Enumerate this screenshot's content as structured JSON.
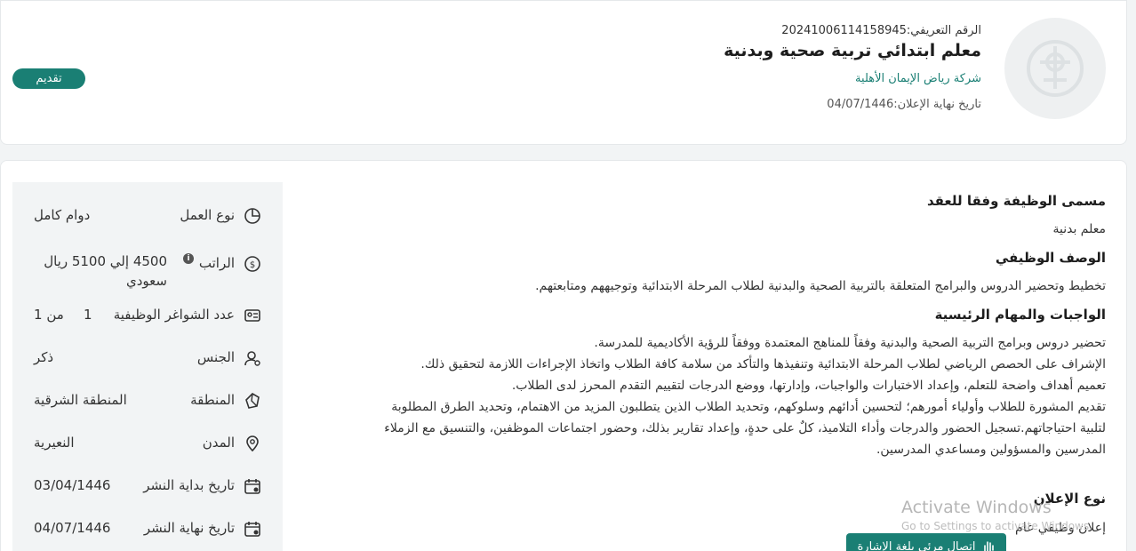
{
  "header": {
    "id_label": "الرقم التعريفي:",
    "id_value": "20241006114158945",
    "job_title": "معلم ابتدائي تربية صحية وبدنية",
    "company": "شركة رياض الإيمان الأهلية",
    "end_date_label": "تاريخ نهاية الإعلان:",
    "end_date_value": "04/07/1446",
    "apply_label": "تقديم"
  },
  "sidebar": {
    "work_type": {
      "label": "نوع العمل",
      "value": "دوام كامل"
    },
    "salary": {
      "label": "الراتب",
      "line1": "4500 إلي 5100 ريال",
      "line2": "سعودي"
    },
    "vacancies": {
      "label": "عدد الشواغر الوظيفية",
      "available": "1",
      "total_text": "من 1"
    },
    "gender": {
      "label": "الجنس",
      "value": "ذكر"
    },
    "region": {
      "label": "المنطقة",
      "value": "المنطقة الشرقية"
    },
    "city": {
      "label": "المدن",
      "value": "النعيرية"
    },
    "publish_start": {
      "label": "تاريخ بداية النشر",
      "value": "03/04/1446"
    },
    "publish_end": {
      "label": "تاريخ نهاية النشر",
      "value": "04/07/1446"
    }
  },
  "content": {
    "contract_title_heading": "مسمى الوظيفة وفقا للعقد",
    "contract_title_value": "معلم بدنية",
    "description_heading": "الوصف الوظيفي",
    "description_text": "تخطيط وتحضير الدروس والبرامج المتعلقة بالتربية الصحية والبدنية لطلاب المرحلة الابتدائية وتوجيههم ومتابعتهم.",
    "duties_heading": "الواجبات والمهام الرئيسية",
    "duties_lines": [
      "تحضير  دروس وبرامج التربية الصحية والبدنية وفقاً للمناهج المعتمدة ووفقاً للرؤية الأكاديمية للمدرسة.",
      "الإشراف على الحصص الرياضي  لطلاب المرحلة الابتدائية  وتنفيذها والتأكد من سلامة كافة الطلاب واتخاذ الإجراءات اللازمة  لتحقيق ذلك.",
      "تعميم أهداف واضحة للتعلم، وإعداد الاختبارات والواجبات، وإدارتها، ووضع الدرجات لتقييم التقدم المحرز لدى الطلاب.",
      "تقديم المشورة للطلاب وأولياء أمورهم؛ لتحسين أدائهم وسلوكهم، وتحديد الطلاب الذين يتطلبون المزيد من الاهتمام، وتحديد الطرق المطلوبة",
      "لتلبية احتياجاتهم.تسجيل الحضور والدرجات وأداء التلاميذ، كلٌ على حدةٍ، وإعداد تقارير بذلك، وحضور اجتماعات الموظفين، والتنسيق مع الزملاء",
      "المدرسين والمسؤولين ومساعدي المدرسين."
    ],
    "ad_type_heading": "نوع الإعلان",
    "ad_type_value": "إعلان وظيفي عام"
  },
  "overlay": {
    "activate_title": "Activate Windows",
    "activate_sub": "Go to Settings to activate Windows.",
    "sign_language_label": "اتصال مرئي بلغة الإشارة"
  },
  "colors": {
    "accent": "#1a7f74",
    "panel": "#f2f4f5"
  }
}
